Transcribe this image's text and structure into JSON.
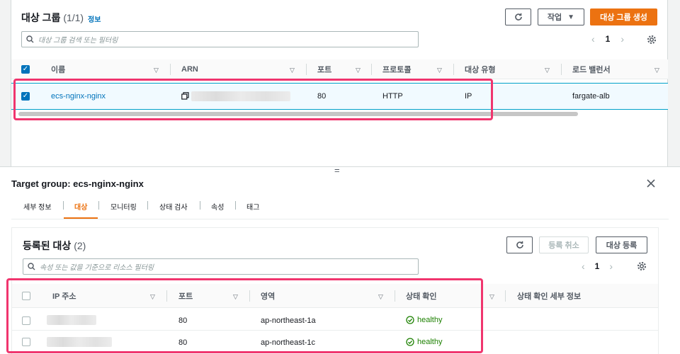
{
  "top": {
    "title": "대상 그룹",
    "count": "(1/1)",
    "info": "정보",
    "actions_label": "작업",
    "create_label": "대상 그룹 생성",
    "search_placeholder": "대상 그룹 검색 또는 필터링",
    "page": "1",
    "columns": [
      "이름",
      "ARN",
      "포트",
      "프로토콜",
      "대상 유형",
      "로드 밸런서"
    ],
    "row": {
      "name": "ecs-nginx-nginx",
      "port": "80",
      "protocol": "HTTP",
      "target_type": "IP",
      "load_balancer": "fargate-alb"
    }
  },
  "resize_handle": "=",
  "detail": {
    "title": "Target group: ecs-nginx-nginx",
    "tabs": [
      "세부 정보",
      "대상",
      "모니터링",
      "상태 검사",
      "속성",
      "태그"
    ],
    "active_tab": 1,
    "targets": {
      "title": "등록된 대상",
      "count": "(2)",
      "deregister_label": "등록 취소",
      "register_label": "대상 등록",
      "search_placeholder": "속성 또는 값을 기준으로 리소스 필터링",
      "page": "1",
      "columns": [
        "IP 주소",
        "포트",
        "영역",
        "상태 확인",
        "상태 확인 세부 정보"
      ],
      "rows": [
        {
          "port": "80",
          "zone": "ap-northeast-1a",
          "status": "healthy"
        },
        {
          "port": "80",
          "zone": "ap-northeast-1c",
          "status": "healthy"
        }
      ]
    }
  },
  "colors": {
    "accent": "#ec7211",
    "link": "#0073bb",
    "highlight": "#f0356e",
    "healthy": "#1d8102"
  }
}
